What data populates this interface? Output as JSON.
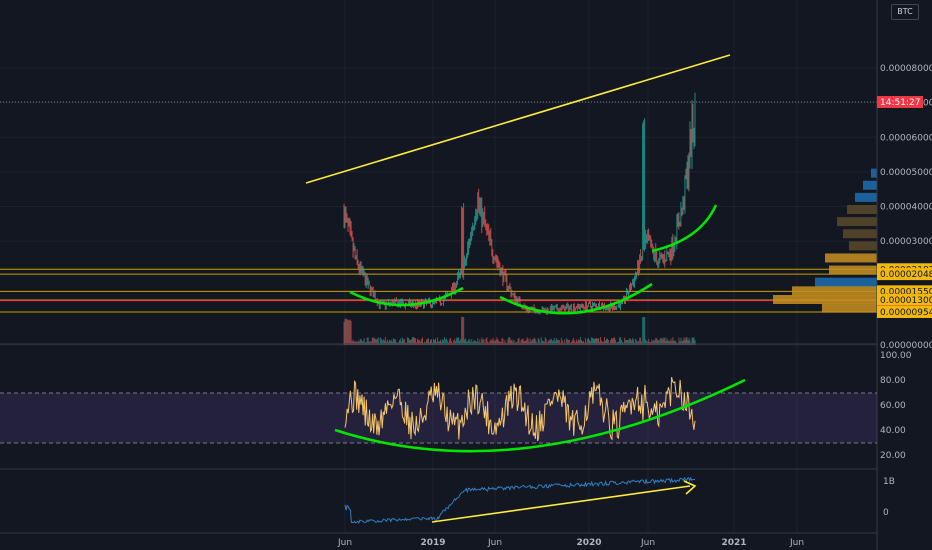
{
  "currency_label": "BTC",
  "time_axis": {
    "labels": [
      "Jun",
      "2019",
      "Jun",
      "2020",
      "Jun",
      "2021",
      "Jun"
    ]
  },
  "price_axis": {
    "ticks": [
      "0.00008000",
      "0.00007000",
      "0.00006000",
      "0.00005000",
      "0.00004000",
      "0.00003000",
      "0.00000000"
    ]
  },
  "price_tags": [
    {
      "label": "14:51:27",
      "color": "#f23645",
      "text_color": "#ffffff"
    },
    {
      "label": "0.00002187",
      "color": "#f0b90b",
      "text_color": "#131722"
    },
    {
      "label": "0.00002048",
      "color": "#f0b90b",
      "text_color": "#131722"
    },
    {
      "label": "0.00001550",
      "color": "#f0b90b",
      "text_color": "#131722"
    },
    {
      "label": "0.00001300",
      "color": "#f0b90b",
      "text_color": "#131722"
    },
    {
      "label": "0.00001283",
      "color": "#e31b1b",
      "text_color": "#ffffff"
    },
    {
      "label": "0.00000954",
      "color": "#f0b90b",
      "text_color": "#131722"
    }
  ],
  "rsi_axis": {
    "ticks": [
      "100.00",
      "80.00",
      "60.00",
      "40.00",
      "20.00"
    ]
  },
  "obv_axis": {
    "ticks": [
      "1B",
      "0"
    ]
  },
  "colors": {
    "background": "#131722",
    "up": "#26a69a",
    "down": "#ef5350",
    "trendline": "#ffeb3b",
    "curve": "#00e600",
    "rsi_line": "#f5c56b",
    "rsi_band": "#2a1f4a",
    "obv_line": "#2f7fc1",
    "level_lines": "#c8a000",
    "red_level": "#f23645",
    "volume_profile_blue": "#1e6fb0",
    "volume_profile_gold": "#c8901e"
  },
  "chart_data": [
    {
      "type": "line",
      "name": "price",
      "x": [
        "2018-05",
        "2018-06",
        "2018-07",
        "2018-08",
        "2018-09",
        "2018-10",
        "2018-11",
        "2018-12",
        "2019-01",
        "2019-02",
        "2019-03",
        "2019-04",
        "2019-05",
        "2019-06",
        "2019-07",
        "2019-08",
        "2019-09",
        "2019-10",
        "2019-11",
        "2019-12",
        "2020-01",
        "2020-02",
        "2020-03",
        "2020-04",
        "2020-05",
        "2020-06",
        "2020-07",
        "2020-08",
        "2020-09",
        "2020-10"
      ],
      "y": [
        3.8e-05,
        2.4e-05,
        1.7e-05,
        1.15e-05,
        1.2e-05,
        1.18e-05,
        1.16e-05,
        1.2e-05,
        1.25e-05,
        1.6e-05,
        2.3e-05,
        4.2e-05,
        3e-05,
        2.1e-05,
        1.4e-05,
        1.05e-05,
        1e-05,
        1.02e-05,
        1.05e-05,
        1.1e-05,
        1.12e-05,
        1.15e-05,
        1.08e-05,
        1.2e-05,
        1.9e-05,
        3e-05,
        2.4e-05,
        2.7e-05,
        4e-05,
        6.8e-05
      ],
      "ylim": [
        0,
        9e-05
      ],
      "levels": [
        2.187e-05,
        2.048e-05,
        1.55e-05,
        1.3e-05,
        1.283e-05,
        9.54e-06
      ]
    },
    {
      "type": "line",
      "name": "rsi",
      "ylim": [
        0,
        100
      ],
      "overbought": 70,
      "oversold": 30
    },
    {
      "type": "line",
      "name": "obv"
    }
  ]
}
